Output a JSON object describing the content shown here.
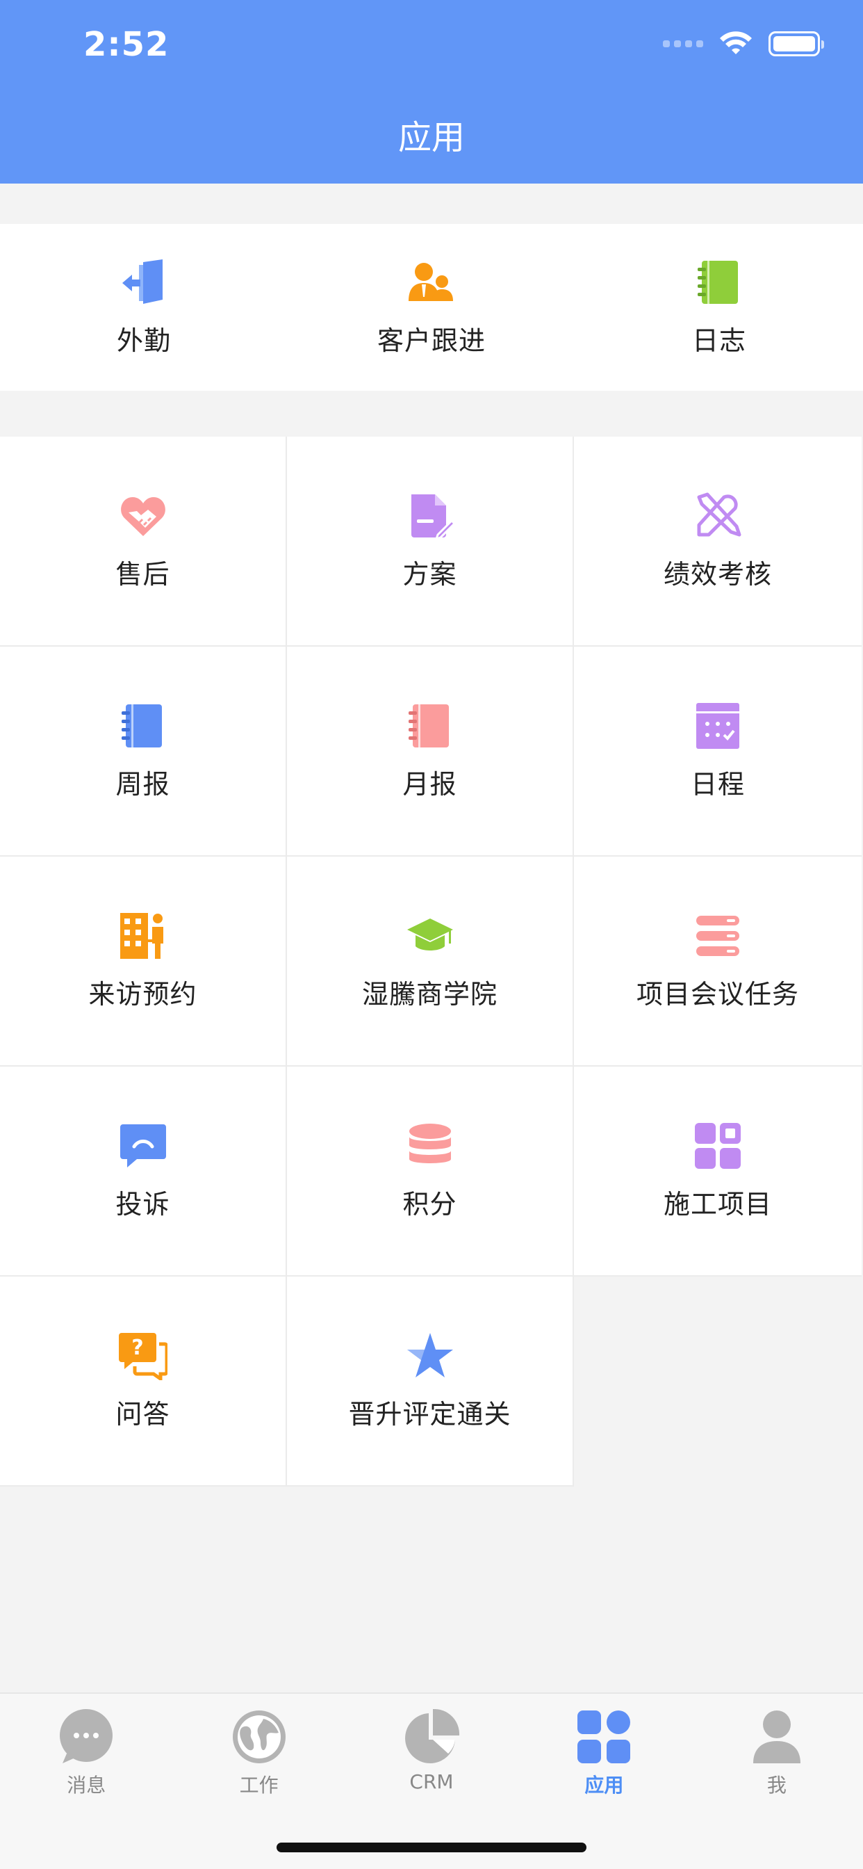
{
  "status": {
    "time": "2:52"
  },
  "header": {
    "title": "应用"
  },
  "quick_apps": [
    {
      "label": "外勤",
      "icon": "door-exit-icon"
    },
    {
      "label": "客户跟进",
      "icon": "customers-icon"
    },
    {
      "label": "日志",
      "icon": "notebook-icon"
    }
  ],
  "apps": [
    {
      "label": "售后",
      "icon": "handshake-heart-icon"
    },
    {
      "label": "方案",
      "icon": "document-edit-icon"
    },
    {
      "label": "绩效考核",
      "icon": "tools-icon"
    },
    {
      "label": "周报",
      "icon": "notebook-icon"
    },
    {
      "label": "月报",
      "icon": "notebook-icon"
    },
    {
      "label": "日程",
      "icon": "calendar-icon"
    },
    {
      "label": "来访预约",
      "icon": "building-visitor-icon"
    },
    {
      "label": "湿騰商学院",
      "icon": "graduation-cap-icon"
    },
    {
      "label": "项目会议任务",
      "icon": "stack-list-icon"
    },
    {
      "label": "投诉",
      "icon": "chat-bubble-icon"
    },
    {
      "label": "积分",
      "icon": "coin-stack-icon"
    },
    {
      "label": "施工项目",
      "icon": "apps-grid-icon"
    },
    {
      "label": "问答",
      "icon": "question-bubble-icon"
    },
    {
      "label": "晋升评定通关",
      "icon": "star-icon"
    }
  ],
  "tabbar": {
    "items": [
      {
        "label": "消息",
        "icon": "message-icon"
      },
      {
        "label": "工作",
        "icon": "globe-icon"
      },
      {
        "label": "CRM",
        "icon": "pie-chart-icon"
      },
      {
        "label": "应用",
        "icon": "apps-icon",
        "active": true
      },
      {
        "label": "我",
        "icon": "person-icon"
      }
    ]
  },
  "colors": {
    "brand": "#6196f7",
    "active_tab": "#4d8ef5",
    "orange": "#f99a13",
    "green": "#8fce3a",
    "pink": "#fb9c9c",
    "purple": "#c08bf2",
    "blue": "#5f8ff5"
  }
}
